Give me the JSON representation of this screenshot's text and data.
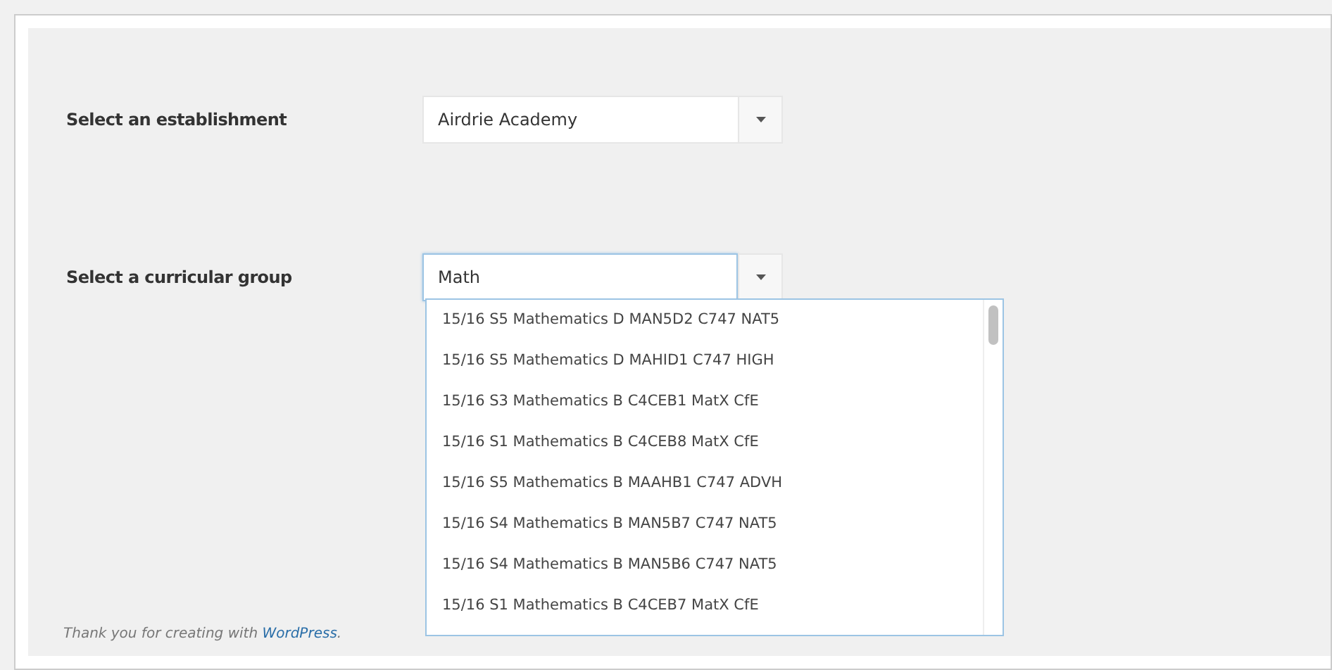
{
  "fields": [
    {
      "label": "Select an establishment",
      "value": "Airdrie Academy",
      "focused": false
    },
    {
      "label": "Select a curricular group",
      "value": "Math",
      "focused": true
    }
  ],
  "dropdown": {
    "options": [
      {
        "label": "15/16 S5 Mathematics D MAN5D2 C747 NAT5"
      },
      {
        "label": "15/16 S5 Mathematics D MAHID1 C747 HIGH"
      },
      {
        "label": "15/16 S3 Mathematics B C4CEB1 MatX CfE"
      },
      {
        "label": "15/16 S1 Mathematics B C4CEB8 MatX CfE"
      },
      {
        "label": "15/16 S5 Mathematics B MAAHB1 C747 ADVH"
      },
      {
        "label": "15/16 S4 Mathematics B MAN5B7 C747 NAT5"
      },
      {
        "label": "15/16 S4 Mathematics B MAN5B6 C747 NAT5"
      },
      {
        "label": "15/16 S1 Mathematics B C4CEB7 MatX CfE"
      }
    ]
  },
  "footer": {
    "before": "Thank you for creating with ",
    "link": "WordPress",
    "after": "."
  }
}
